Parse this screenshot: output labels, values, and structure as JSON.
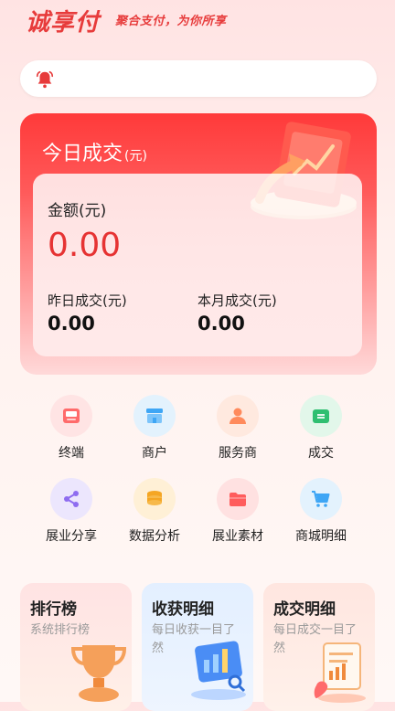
{
  "header": {
    "brand": "诚享付",
    "slogan": "聚合支付，为你所享"
  },
  "notice": {
    "text": ""
  },
  "today": {
    "title": "今日成交",
    "title_unit": "(元)",
    "amount_label": "金额(元)",
    "amount": "0.00",
    "yesterday_label": "昨日成交(元)",
    "yesterday_value": "0.00",
    "month_label": "本月成交(元)",
    "month_value": "0.00"
  },
  "menu": [
    {
      "label": "终端",
      "icon": "terminal-icon",
      "color": "#ff6b6b",
      "bg": "#ffe4e4"
    },
    {
      "label": "商户",
      "icon": "store-icon",
      "color": "#3ea6f5",
      "bg": "#e3f2fd"
    },
    {
      "label": "服务商",
      "icon": "person-icon",
      "color": "#ff8a5c",
      "bg": "#ffe9df"
    },
    {
      "label": "成交",
      "icon": "wallet-icon",
      "color": "#2fbf71",
      "bg": "#e2f7ea"
    },
    {
      "label": "展业分享",
      "icon": "share-icon",
      "color": "#8e6cf0",
      "bg": "#ece6fd"
    },
    {
      "label": "数据分析",
      "icon": "coins-icon",
      "color": "#f5a623",
      "bg": "#fff0d6"
    },
    {
      "label": "展业素材",
      "icon": "folder-icon",
      "color": "#ff5c5c",
      "bg": "#ffe1e1"
    },
    {
      "label": "商城明细",
      "icon": "cart-icon",
      "color": "#3ea6f5",
      "bg": "#e3f2fd"
    }
  ],
  "cards": [
    {
      "title": "排行榜",
      "sub": "系统排行榜"
    },
    {
      "title": "收获明细",
      "sub": "每日收获一目了然"
    },
    {
      "title": "成交明细",
      "sub": "每日成交一目了然"
    }
  ],
  "colors": {
    "accent": "#e73b3b",
    "card_red": "#ff3a3a"
  }
}
